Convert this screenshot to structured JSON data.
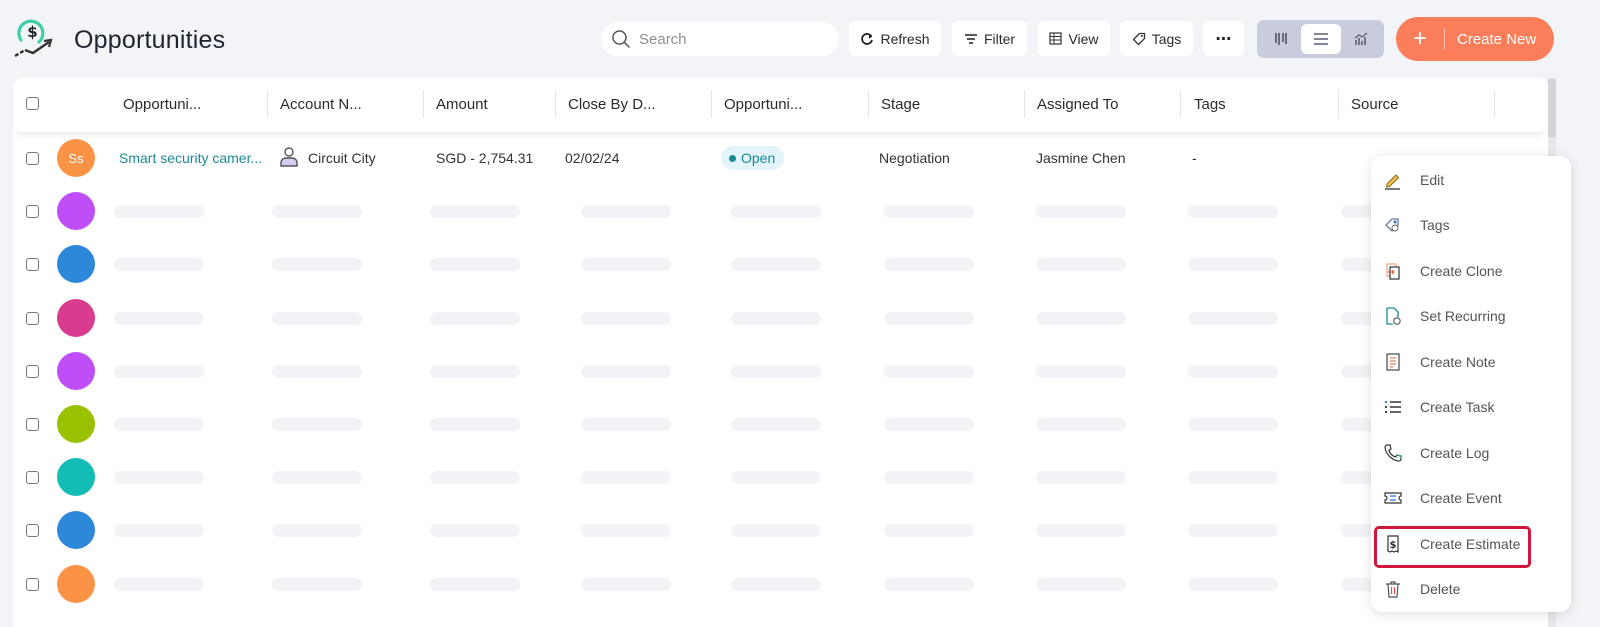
{
  "header": {
    "title": "Opportunities",
    "logo_icon": "dollar-growth-icon",
    "search": {
      "placeholder": "Search",
      "value": ""
    },
    "buttons": {
      "refresh": "Refresh",
      "filter": "Filter",
      "view": "View",
      "tags": "Tags",
      "more": "⋯"
    },
    "view_modes": [
      "kanban",
      "list",
      "chart"
    ],
    "active_view": "list",
    "create_new": {
      "plus": "+",
      "label": "Create New"
    }
  },
  "colors": {
    "accent": "#fc7d5a",
    "link": "#1b8a97",
    "highlight": "#d0173b"
  },
  "table": {
    "columns": [
      "Opportuni...",
      "Account N...",
      "Amount",
      "Close By D...",
      "Opportuni...",
      "Stage",
      "Assigned To",
      "Tags",
      "Source"
    ],
    "rows": [
      {
        "avatar_initials": "Ss",
        "avatar_color": "#fb9346",
        "opportunity_name": "Smart security camer...",
        "account_name": "Circuit City",
        "amount": "SGD - 2,754.31",
        "close_by_date": "02/02/24",
        "status": "Open",
        "stage": "Negotiation",
        "assigned_to": "Jasmine Chen",
        "tags": "-",
        "source": ""
      },
      {
        "avatar_initials": "",
        "avatar_color": "#bf4ef8",
        "placeholder": true
      },
      {
        "avatar_initials": "",
        "avatar_color": "#2e88d9",
        "placeholder": true
      },
      {
        "avatar_initials": "",
        "avatar_color": "#d93b8e",
        "placeholder": true
      },
      {
        "avatar_initials": "",
        "avatar_color": "#bf4ef8",
        "placeholder": true
      },
      {
        "avatar_initials": "",
        "avatar_color": "#98c100",
        "placeholder": true
      },
      {
        "avatar_initials": "",
        "avatar_color": "#12bdb5",
        "placeholder": true
      },
      {
        "avatar_initials": "",
        "avatar_color": "#2e88d9",
        "placeholder": true
      },
      {
        "avatar_initials": "",
        "avatar_color": "#fb9346",
        "placeholder": true
      }
    ]
  },
  "context_menu": {
    "items": [
      {
        "label": "Edit",
        "icon": "pencil-icon"
      },
      {
        "label": "Tags",
        "icon": "tag-icon"
      },
      {
        "label": "Create Clone",
        "icon": "clone-icon"
      },
      {
        "label": "Set Recurring",
        "icon": "recurring-document-icon"
      },
      {
        "label": "Create Note",
        "icon": "note-icon"
      },
      {
        "label": "Create Task",
        "icon": "task-list-icon"
      },
      {
        "label": "Create Log",
        "icon": "phone-icon"
      },
      {
        "label": "Create Event",
        "icon": "ticket-icon"
      },
      {
        "label": "Create Estimate",
        "icon": "estimate-dollar-icon",
        "highlighted": true
      },
      {
        "label": "Delete",
        "icon": "trash-icon"
      }
    ]
  }
}
